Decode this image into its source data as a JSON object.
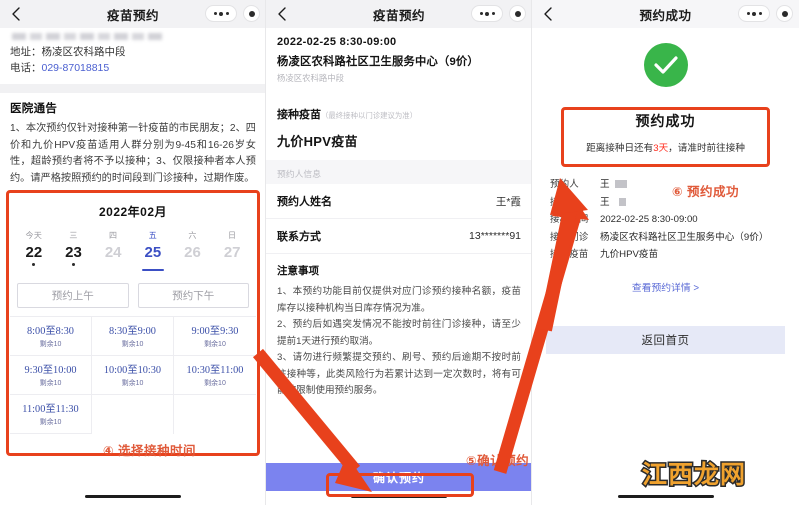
{
  "watermark": "江西龙网",
  "colors": {
    "accent_blue": "#3b4fc4",
    "annotation_red": "#e8411c",
    "success_green": "#39b54a",
    "confirm_purple": "#7b83ef",
    "alert_red": "#ff2d1f"
  },
  "panel1": {
    "header": {
      "title": "疫苗预约",
      "back_icon": "chevron-left-icon",
      "more_icon": "more-dots-icon",
      "target_icon": "target-circle-icon"
    },
    "info": {
      "address_label": "地址：",
      "address_value": "杨凌区农科路中段",
      "phone_label": "电话：",
      "phone_value": "029-87018815"
    },
    "notice": {
      "title": "医院通告",
      "body": "1、本次预约仅针对接种第一针疫苗的市民朋友；2、四价和九价HPV疫苗适用人群分别为9-45和16-26岁女性，超龄预约者将不予以接种；3、仅限接种者本人预约。请严格按照预约的时间段到门诊接种，过期作废。"
    },
    "calendar": {
      "month": "2022年02月",
      "days": [
        {
          "weekday": "今天",
          "date": "22",
          "state": "enabled",
          "dot": true
        },
        {
          "weekday": "三",
          "date": "23",
          "state": "enabled",
          "dot": true
        },
        {
          "weekday": "四",
          "date": "24",
          "state": "disabled",
          "dot": false
        },
        {
          "weekday": "五",
          "date": "25",
          "state": "selected",
          "dot": false
        },
        {
          "weekday": "六",
          "date": "26",
          "state": "disabled",
          "dot": false
        },
        {
          "weekday": "日",
          "date": "27",
          "state": "disabled",
          "dot": false
        }
      ],
      "am_button": "预约上午",
      "pm_button": "预约下午",
      "slots": [
        {
          "time": "8:00至8:30",
          "remain": "剩余10"
        },
        {
          "time": "8:30至9:00",
          "remain": "剩余10"
        },
        {
          "time": "9:00至9:30",
          "remain": "剩余10"
        },
        {
          "time": "9:30至10:00",
          "remain": "剩余10"
        },
        {
          "time": "10:00至10:30",
          "remain": "剩余10"
        },
        {
          "time": "10:30至11:00",
          "remain": "剩余10"
        },
        {
          "time": "11:00至11:30",
          "remain": "剩余10"
        }
      ]
    },
    "annotation": "④ 选择接种时间"
  },
  "panel2": {
    "header": {
      "title": "疫苗预约",
      "back_icon": "chevron-left-icon",
      "more_icon": "more-dots-icon",
      "target_icon": "target-circle-icon"
    },
    "appointment": {
      "datetime": "2022-02-25 8:30-09:00",
      "site": "杨凌区农科路社区卫生服务中心（9价）",
      "address": "杨凌区农科路中段",
      "vaccine_label": "接种疫苗",
      "vaccine_note": "（最终接种以门诊建议为准）",
      "vaccine_value": "九价HPV疫苗"
    },
    "person_section_label": "预约人信息",
    "rows": [
      {
        "key": "预约人姓名",
        "value": "王*霞"
      },
      {
        "key": "联系方式",
        "value": "13*******91"
      }
    ],
    "notes": {
      "title": "注意事项",
      "body": "1、本预约功能目前仅提供对应门诊预约接种名额，疫苗库存以接种机构当日库存情况为准。\n2、预约后如遇突发情况不能按时前往门诊接种，请至少提前1天进行预约取消。\n3、请勿进行频繁提交预约、刷号、预约后逾期不按时前往接种等，此类风险行为若累计达到一定次数时，将有可能被限制使用预约服务。"
    },
    "confirm_button": "确认预约",
    "annotation": "⑤确认预约"
  },
  "panel3": {
    "header": {
      "title": "预约成功",
      "back_icon": "chevron-left-icon",
      "more_icon": "more-dots-icon",
      "target_icon": "target-circle-icon"
    },
    "success": {
      "check_icon": "check-circle-icon",
      "title": "预约成功",
      "subtitle_prefix": "距离接种日还有",
      "subtitle_highlight": "3天",
      "subtitle_suffix": "，请准时前往接种"
    },
    "details": [
      {
        "key": "预约人",
        "value": "王"
      },
      {
        "key": "接种人",
        "value": "王"
      },
      {
        "key": "接种时间",
        "value": "2022-02-25 8:30-09:00"
      },
      {
        "key": "接种门诊",
        "value": "杨凌区农科路社区卫生服务中心（9价）"
      },
      {
        "key": "接种疫苗",
        "value": "九价HPV疫苗"
      }
    ],
    "detail_link": "查看预约详情 >",
    "home_button": "返回首页",
    "annotation": "⑥ 预约成功"
  }
}
